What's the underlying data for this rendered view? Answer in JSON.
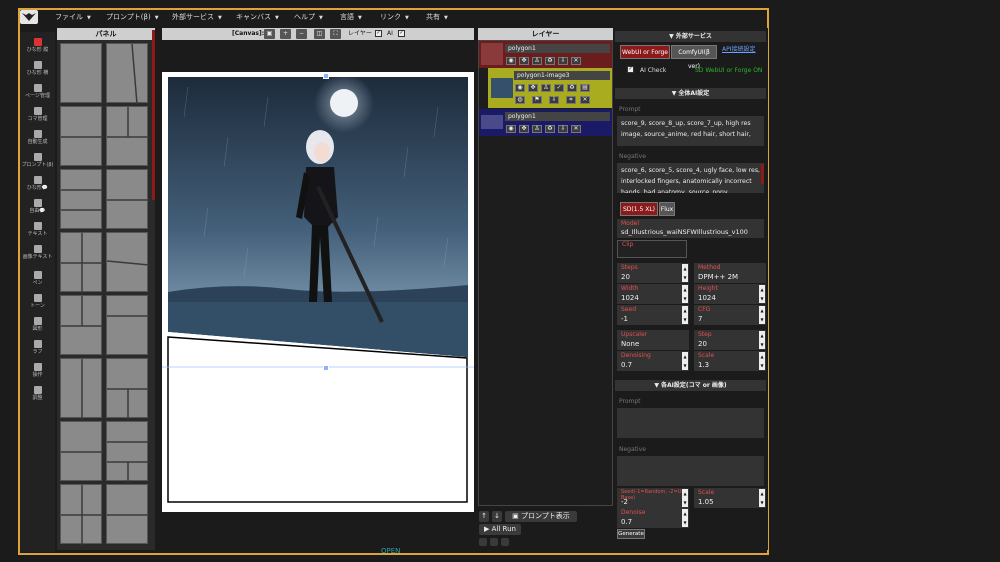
{
  "menubar": {
    "items": [
      "ファイル",
      "プロンプト(β)",
      "外部サービス",
      "キャンバス",
      "ヘルプ",
      "言語",
      "リンク",
      "共有"
    ]
  },
  "toolbar": {
    "tools": [
      "ひな形 縦",
      "ひな形 横",
      "ページ管理",
      "コマ管理",
      "自動生成",
      "プロンプト(β)",
      "ひな形💬",
      "自由💬",
      "テキスト",
      "画像テキスト",
      "ペン",
      "トーン",
      "図形",
      "ラフ",
      "操作",
      "調整"
    ]
  },
  "panel": {
    "title": "パネル"
  },
  "canvas": {
    "label": "[Canvas]:",
    "layer_label": "レイヤー",
    "ai_label": "AI",
    "check": "✓"
  },
  "layers": {
    "title": "レイヤー",
    "items": [
      {
        "name": "polygon1"
      },
      {
        "name": "polygon1-image3"
      },
      {
        "name": "polygon1"
      }
    ],
    "prompt_button": "プロンプト表示",
    "all_run": "All Run",
    "up": "↑",
    "down": "↓"
  },
  "external": {
    "title": "▼ 外部サービス",
    "webui": "WebUI or Forge",
    "comfy": "ComfyUI(β ver)",
    "api_link": "API接続設定",
    "ai_check": "AI Check",
    "status": "SD WebUI or Forge ON"
  },
  "global_ai": {
    "title": "▼ 全体AI設定",
    "prompt_label": "Prompt",
    "prompt": "score_9, score_8_up, score_7_up, high res image, source_anime, red hair, short hair,",
    "negative_label": "Negative",
    "negative": "score_6, score_5, score_4, ugly face, low res, interlocked fingers, anatomically incorrect hands, bad anatomy, source_pony",
    "sd_btn": "SD(1.5 XL)",
    "flux_btn": "Flux",
    "model_label": "Model",
    "model": "sd_Illustrious_waiNSFWIllustrious_v100",
    "clip_label": "Clip",
    "steps": {
      "label": "Steps",
      "value": "20"
    },
    "method": {
      "label": "Method",
      "value": "DPM++ 2M"
    },
    "width": {
      "label": "Width",
      "value": "1024"
    },
    "height": {
      "label": "Height",
      "value": "1024"
    },
    "seed": {
      "label": "Seed",
      "value": "-1"
    },
    "cfg": {
      "label": "CFG",
      "value": "7"
    },
    "upscaler": {
      "label": "Upscaler",
      "value": "None"
    },
    "step": {
      "label": "Step",
      "value": "20"
    },
    "denoising": {
      "label": "Denoising",
      "value": "0.7"
    },
    "scale": {
      "label": "Scale",
      "value": "1.3"
    }
  },
  "each_ai": {
    "title": "▼ 各AI設定(コマ or 画像)",
    "prompt_label": "Prompt",
    "negative_label": "Negative",
    "seed": {
      "label": "Seed(-1=Random, -2=Use Base)",
      "value": "-2"
    },
    "scale": {
      "label": "Scale",
      "value": "1.05"
    },
    "denoise": {
      "label": "Denoise",
      "value": "0.7"
    },
    "generate": "Generate"
  },
  "footer": {
    "open": "OPEN"
  },
  "colors": {
    "accent": "#e0a33c",
    "red": "#8b1a1a",
    "layer_yellow": "#a8ac1e",
    "layer_navy": "#1a1a66"
  }
}
